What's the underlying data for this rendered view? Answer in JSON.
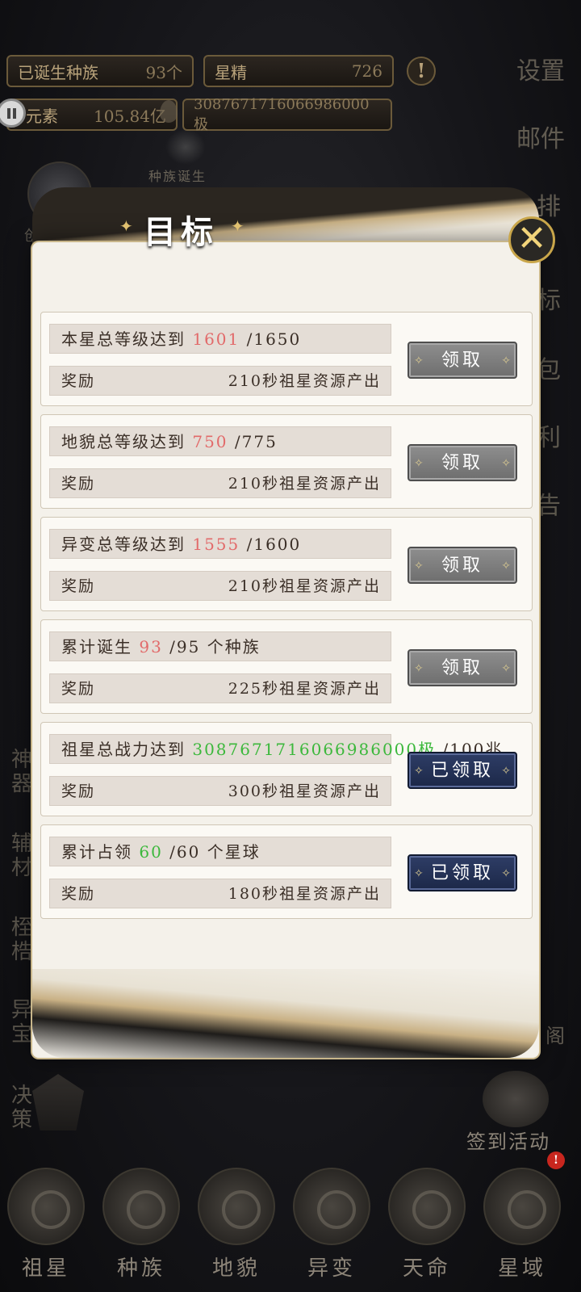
{
  "top_bar": {
    "species_born_label": "已诞生种族",
    "species_born_value": "93个",
    "star_essence_label": "星精",
    "star_essence_value": "726",
    "element_label": "元素",
    "element_value": "105.84亿",
    "power_value": "3087671716066986000极",
    "warn_glyph": "!"
  },
  "species_birth_label": "种族诞生",
  "left_partial_label": "创世风",
  "right_menu": [
    "设置",
    "邮件",
    "排",
    "标",
    "包",
    "利",
    "告"
  ],
  "left_menu": [
    "神器",
    "辅材",
    "桎梏",
    "异宝",
    "决策"
  ],
  "right_bottom_partial": "阁",
  "checkin_label": "签到活动",
  "notification_badge": "!",
  "bottom_nav": [
    "祖星",
    "种族",
    "地貌",
    "异变",
    "天命",
    "星域"
  ],
  "modal": {
    "title": "目标",
    "close_glyph": "✕",
    "reward_label": "奖励",
    "claim_label": "领取",
    "claimed_label": "已领取",
    "tasks": [
      {
        "prefix": "本星总等级达到 ",
        "current": "1601",
        "target": " /1650",
        "color": "red",
        "reward": "210秒祖星资源产出",
        "claimed": false
      },
      {
        "prefix": "地貌总等级达到 ",
        "current": "750",
        "target": " /775",
        "color": "red",
        "reward": "210秒祖星资源产出",
        "claimed": false
      },
      {
        "prefix": "异变总等级达到 ",
        "current": "1555",
        "target": " /1600",
        "color": "red",
        "reward": "210秒祖星资源产出",
        "claimed": false
      },
      {
        "prefix": "累计诞生 ",
        "current": "93",
        "target": " /95 个种族",
        "color": "red",
        "reward": "225秒祖星资源产出",
        "claimed": false
      },
      {
        "prefix": "祖星总战力达到 ",
        "current": "3087671716066986000极",
        "target": " /100兆",
        "color": "green",
        "reward": "300秒祖星资源产出",
        "claimed": true
      },
      {
        "prefix": "累计占领 ",
        "current": "60",
        "target": " /60 个星球",
        "color": "green",
        "reward": "180秒祖星资源产出",
        "claimed": true
      }
    ]
  }
}
